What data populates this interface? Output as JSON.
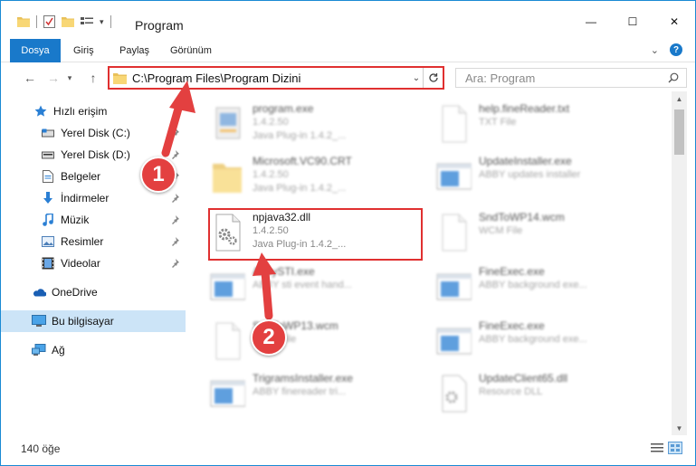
{
  "window": {
    "title": "Program",
    "minimize": "—",
    "maximize": "☐",
    "close": "✕"
  },
  "ribbon": {
    "tabs": [
      "Dosya",
      "Giriş",
      "Paylaş",
      "Görünüm"
    ],
    "help": "?"
  },
  "nav": {
    "back": "←",
    "forward": "→",
    "recent": "▾",
    "up": "↑"
  },
  "address": {
    "path": "C:\\Program Files\\Program Dizini"
  },
  "search": {
    "placeholder": "Ara: Program"
  },
  "sidebar": {
    "items": [
      {
        "label": "Hızlı erişim",
        "icon": "star-icon"
      },
      {
        "label": "Yerel Disk (C:)",
        "icon": "drive-icon"
      },
      {
        "label": "Yerel Disk (D:)",
        "icon": "drive-icon"
      },
      {
        "label": "Belgeler",
        "icon": "documents-icon"
      },
      {
        "label": "İndirmeler",
        "icon": "download-icon"
      },
      {
        "label": "Müzik",
        "icon": "music-icon"
      },
      {
        "label": "Resimler",
        "icon": "pictures-icon"
      },
      {
        "label": "Videolar",
        "icon": "video-icon"
      },
      {
        "label": "OneDrive",
        "icon": "cloud-icon"
      },
      {
        "label": "Bu bilgisayar",
        "icon": "computer-icon"
      },
      {
        "label": "Ağ",
        "icon": "network-icon"
      }
    ]
  },
  "files": [
    {
      "name": "program.exe",
      "l1": "1.4.2.50",
      "l2": "Java Plug-in 1.4.2_..."
    },
    {
      "name": "help.fineReader.txt",
      "l1": "TXT File",
      "l2": ""
    },
    {
      "name": "Microsoft.VC90.CRT",
      "l1": "1.4.2.50",
      "l2": "Java Plug-in 1.4.2_..."
    },
    {
      "name": "UpdateInstaller.exe",
      "l1": "ABBY updates installer",
      "l2": ""
    },
    {
      "name": "npjava32.dll",
      "l1": "1.4.2.50",
      "l2": "Java Plug-in 1.4.2_..."
    },
    {
      "name": "SndToWP14.wcm",
      "l1": "WCM File",
      "l2": ""
    },
    {
      "name": "AbbySTI.exe",
      "l1": "ABBY sti event hand...",
      "l2": ""
    },
    {
      "name": "FineExec.exe",
      "l1": "ABBY background exe...",
      "l2": ""
    },
    {
      "name": "SndToWP13.wcm",
      "l1": "WCM File",
      "l2": ""
    },
    {
      "name": "FineExec.exe",
      "l1": "ABBY background exe...",
      "l2": ""
    },
    {
      "name": "TrigramsInstaller.exe",
      "l1": "ABBY finereader tri...",
      "l2": ""
    },
    {
      "name": "UpdateClient65.dll",
      "l1": "Resource DLL",
      "l2": ""
    }
  ],
  "status": {
    "count": "140 öğe"
  },
  "annotations": {
    "step1": "1",
    "step2": "2"
  },
  "colors": {
    "accent": "#1979ca",
    "highlight": "#e03030",
    "selected": "#cce4f7"
  }
}
